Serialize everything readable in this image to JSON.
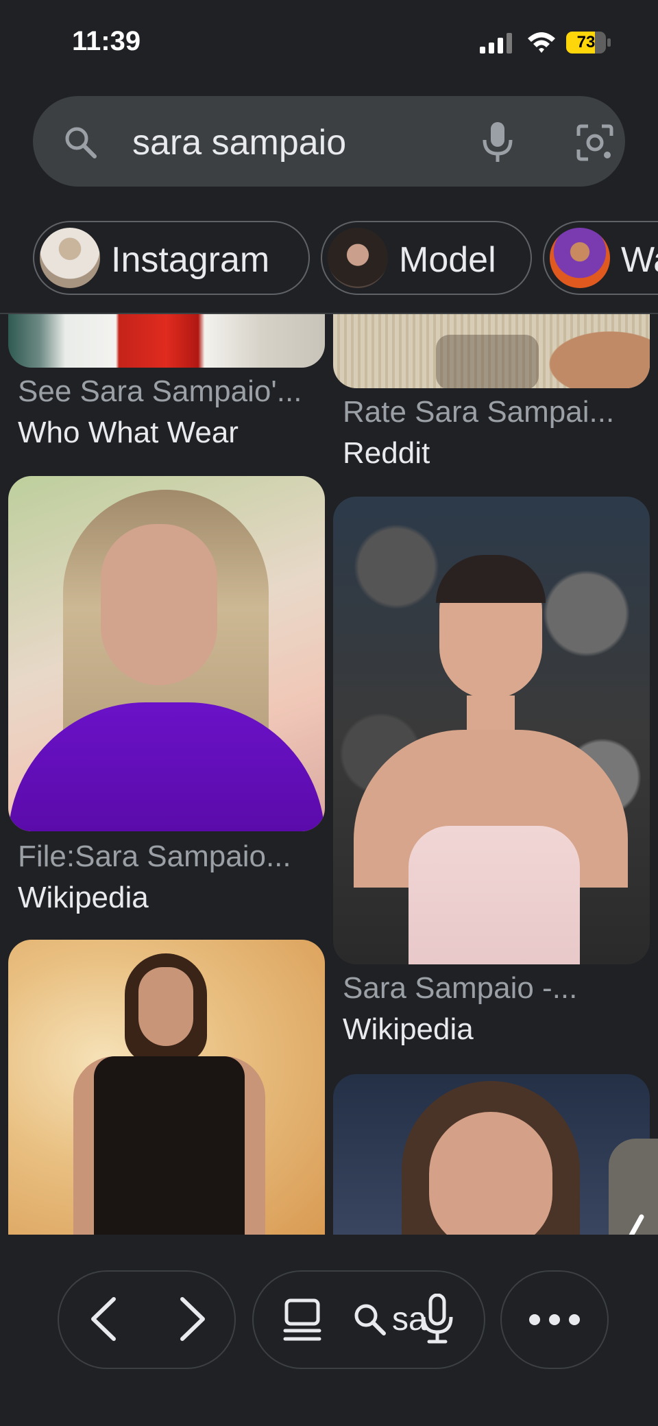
{
  "status": {
    "time": "11:39",
    "battery": "73",
    "battery_level": 0.73
  },
  "search": {
    "query": "sara sampaio"
  },
  "chips": [
    {
      "label": "Instagram"
    },
    {
      "label": "Model"
    },
    {
      "label": "Wa"
    }
  ],
  "results": [
    {
      "caption": "See Sara Sampaio'...",
      "source": "Who What Wear"
    },
    {
      "caption": "Rate Sara Sampai...",
      "source": "Reddit"
    },
    {
      "caption": "File:Sara Sampaio...",
      "source": "Wikipedia"
    },
    {
      "caption": "Sara Sampaio -...",
      "source": "Wikipedia"
    }
  ],
  "bottom_bar": {
    "address_text": "sa"
  },
  "icons": [
    "search-icon",
    "mic-icon",
    "lens-icon",
    "back-icon",
    "forward-icon",
    "tabs-icon",
    "more-icon"
  ]
}
